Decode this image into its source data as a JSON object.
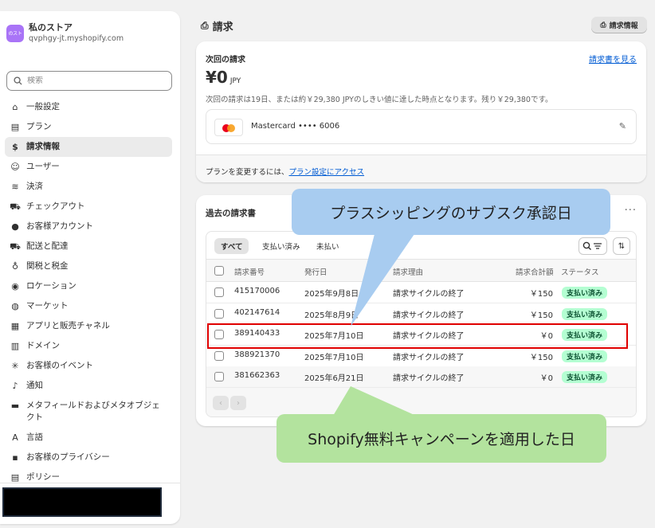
{
  "sidebar": {
    "store_avatar_text": "のスト",
    "store_name": "私のストア",
    "store_domain": "qvphgy-jt.myshopify.com",
    "search_placeholder": "検索",
    "items": [
      {
        "label": "一般設定",
        "icon": "store-icon",
        "glyph": "⌂"
      },
      {
        "label": "プラン",
        "icon": "plan-icon",
        "glyph": "▤"
      },
      {
        "label": "請求情報",
        "icon": "billing-icon",
        "glyph": "$"
      },
      {
        "label": "ユーザー",
        "icon": "users-icon",
        "glyph": "☺"
      },
      {
        "label": "決済",
        "icon": "payments-icon",
        "glyph": "≋"
      },
      {
        "label": "チェックアウト",
        "icon": "cart-icon",
        "glyph": "⛟"
      },
      {
        "label": "お客様アカウント",
        "icon": "person-icon",
        "glyph": "●"
      },
      {
        "label": "配送と配達",
        "icon": "truck-icon",
        "glyph": "⛟"
      },
      {
        "label": "関税と税金",
        "icon": "tax-icon",
        "glyph": "♁"
      },
      {
        "label": "ロケーション",
        "icon": "location-icon",
        "glyph": "◉"
      },
      {
        "label": "マーケット",
        "icon": "globe-icon",
        "glyph": "◍"
      },
      {
        "label": "アプリと販売チャネル",
        "icon": "apps-icon",
        "glyph": "▦"
      },
      {
        "label": "ドメイン",
        "icon": "domain-icon",
        "glyph": "▥"
      },
      {
        "label": "お客様のイベント",
        "icon": "events-icon",
        "glyph": "✳"
      },
      {
        "label": "通知",
        "icon": "bell-icon",
        "glyph": "♪"
      },
      {
        "label": "メタフィールドおよびメタオブジェクト",
        "icon": "metafield-icon",
        "glyph": "▬"
      },
      {
        "label": "言語",
        "icon": "language-icon",
        "glyph": "A"
      },
      {
        "label": "お客様のプライバシー",
        "icon": "lock-icon",
        "glyph": "▪"
      },
      {
        "label": "ポリシー",
        "icon": "policy-icon",
        "glyph": "▤"
      }
    ]
  },
  "header": {
    "title": "請求",
    "billing_button": "請求情報"
  },
  "next_bill": {
    "title": "次回の請求",
    "view_link": "請求書を見る",
    "amount": "¥0",
    "currency": "JPY",
    "description": "次回の請求は19日、または約￥29,380 JPYのしきい値に達した時点となります。残り￥29,380です。",
    "card_label": "Mastercard •••• 6006",
    "footer_text": "プランを変更するには、",
    "footer_link": "プラン設定にアクセス"
  },
  "past_bills": {
    "title": "過去の請求書",
    "more": "···",
    "tabs": [
      "すべて",
      "支払い済み",
      "未払い"
    ],
    "columns": {
      "number": "請求番号",
      "date": "発行日",
      "reason": "請求理由",
      "total": "請求合計額",
      "status": "ステータス"
    },
    "rows": [
      {
        "number": "415170006",
        "date": "2025年9月8日",
        "reason": "請求サイクルの終了",
        "total": "￥150",
        "status": "支払い済み"
      },
      {
        "number": "402147614",
        "date": "2025年8月9日",
        "reason": "請求サイクルの終了",
        "total": "￥150",
        "status": "支払い済み"
      },
      {
        "number": "389140433",
        "date": "2025年7月10日",
        "reason": "請求サイクルの終了",
        "total": "￥0",
        "status": "支払い済み"
      },
      {
        "number": "388921370",
        "date": "2025年7月10日",
        "reason": "請求サイクルの終了",
        "total": "￥150",
        "status": "支払い済み"
      },
      {
        "number": "381662363",
        "date": "2025年6月21日",
        "reason": "請求サイクルの終了",
        "total": "￥0",
        "status": "支払い済み"
      }
    ]
  },
  "annotations": {
    "callout_top": "プラスシッピングのサブスク承認日",
    "callout_bottom": "Shopify無料キャンペーンを適用した日"
  },
  "colors": {
    "callout_top": "#a8ccf0",
    "callout_bottom": "#b3e39e",
    "highlight": "#e00000",
    "badge": "#b4fed2"
  }
}
